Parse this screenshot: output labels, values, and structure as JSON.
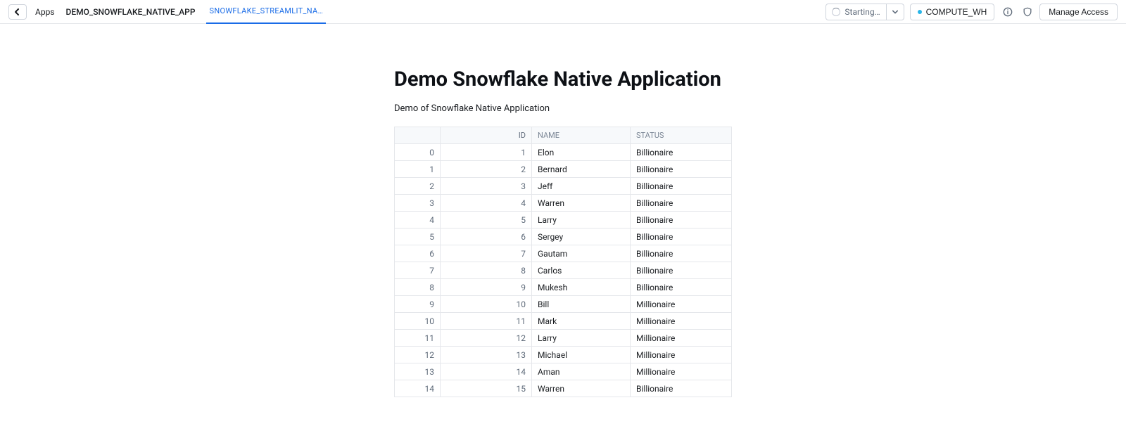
{
  "header": {
    "apps_label": "Apps",
    "app_name": "DEMO_SNOWFLAKE_NATIVE_APP",
    "tab_label": "SNOWFLAKE_STREAMLIT_NA…",
    "status_label": "Starting…",
    "warehouse": "COMPUTE_WH",
    "manage_access": "Manage Access"
  },
  "page": {
    "title": "Demo Snowflake Native Application",
    "subtitle": "Demo of Snowflake Native Application"
  },
  "table": {
    "columns": {
      "id": "ID",
      "name": "NAME",
      "status": "STATUS"
    },
    "rows": [
      {
        "idx": "0",
        "id": "1",
        "name": "Elon",
        "status": "Billionaire"
      },
      {
        "idx": "1",
        "id": "2",
        "name": "Bernard",
        "status": "Billionaire"
      },
      {
        "idx": "2",
        "id": "3",
        "name": "Jeff",
        "status": "Billionaire"
      },
      {
        "idx": "3",
        "id": "4",
        "name": "Warren",
        "status": "Billionaire"
      },
      {
        "idx": "4",
        "id": "5",
        "name": "Larry",
        "status": "Billionaire"
      },
      {
        "idx": "5",
        "id": "6",
        "name": "Sergey",
        "status": "Billionaire"
      },
      {
        "idx": "6",
        "id": "7",
        "name": "Gautam",
        "status": "Billionaire"
      },
      {
        "idx": "7",
        "id": "8",
        "name": "Carlos",
        "status": "Billionaire"
      },
      {
        "idx": "8",
        "id": "9",
        "name": "Mukesh",
        "status": "Billionaire"
      },
      {
        "idx": "9",
        "id": "10",
        "name": "Bill",
        "status": "Millionaire"
      },
      {
        "idx": "10",
        "id": "11",
        "name": "Mark",
        "status": "Millionaire"
      },
      {
        "idx": "11",
        "id": "12",
        "name": "Larry",
        "status": "Millionaire"
      },
      {
        "idx": "12",
        "id": "13",
        "name": "Michael",
        "status": "Millionaire"
      },
      {
        "idx": "13",
        "id": "14",
        "name": "Aman",
        "status": "Millionaire"
      },
      {
        "idx": "14",
        "id": "15",
        "name": "Warren",
        "status": "Billionaire"
      }
    ]
  }
}
